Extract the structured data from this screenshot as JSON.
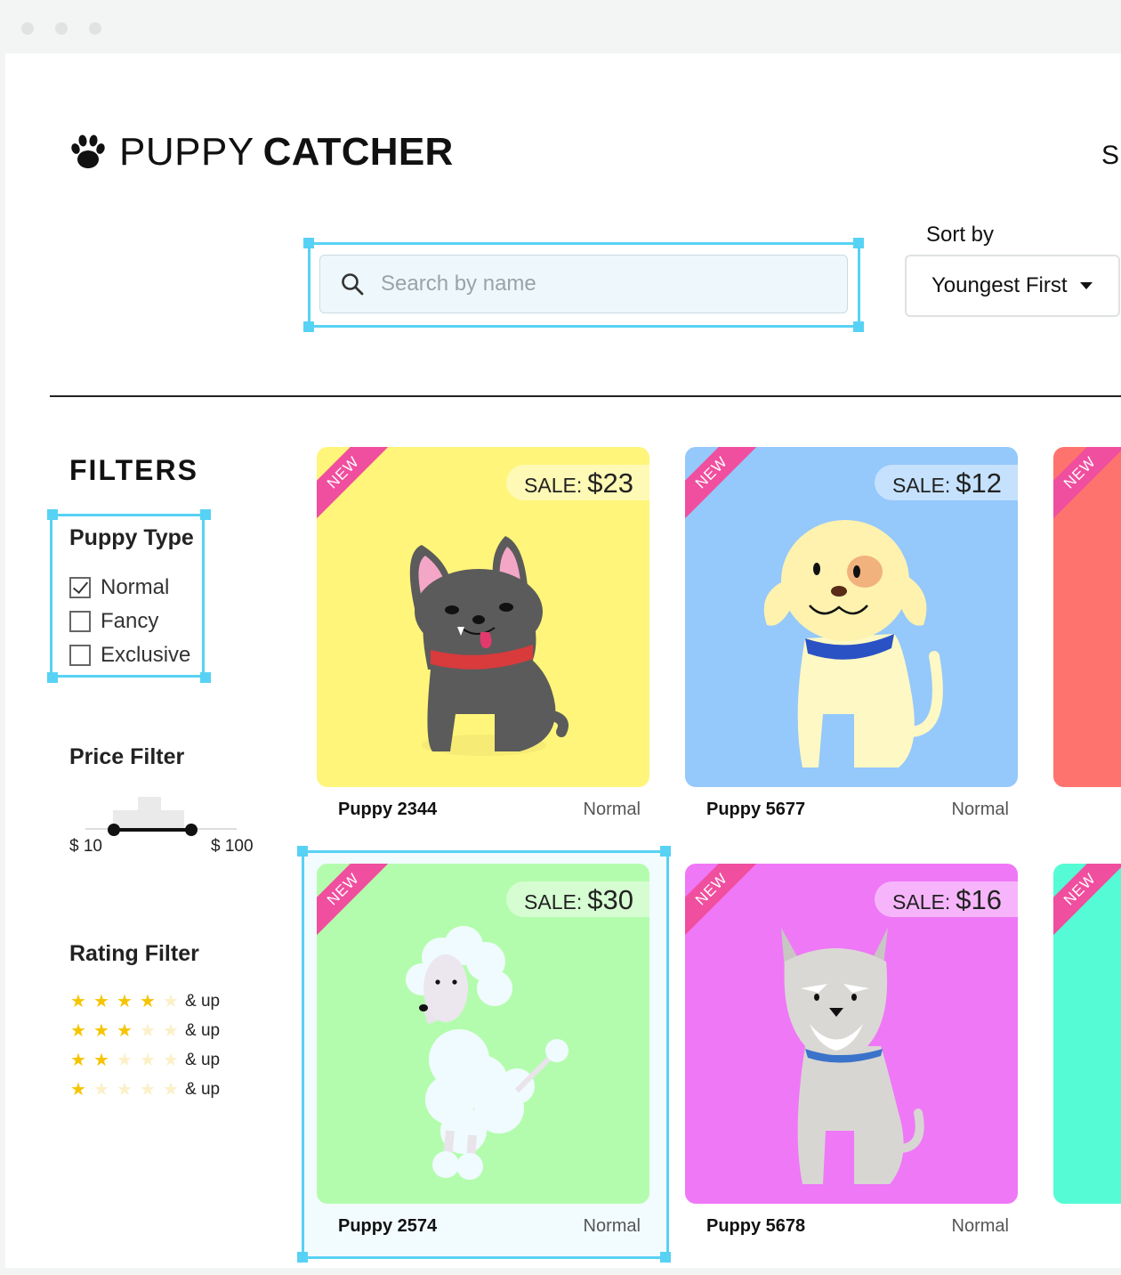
{
  "brand": {
    "name_light": "PUPPY",
    "name_bold": "CATCHER"
  },
  "header": {
    "signin_label": "Si"
  },
  "search": {
    "placeholder": "Search by name"
  },
  "sort": {
    "label": "Sort by",
    "selected": "Youngest First"
  },
  "filters": {
    "title": "FILTERS",
    "puppy_type": {
      "title": "Puppy Type",
      "options": [
        {
          "label": "Normal",
          "checked": true
        },
        {
          "label": "Fancy",
          "checked": false
        },
        {
          "label": "Exclusive",
          "checked": false
        }
      ]
    },
    "price": {
      "title": "Price Filter",
      "min_label": "$ 10",
      "max_label": "$ 100"
    },
    "rating": {
      "title": "Rating Filter",
      "rows": [
        {
          "stars": 4,
          "label": "& up"
        },
        {
          "stars": 3,
          "label": "& up"
        },
        {
          "stars": 2,
          "label": "& up"
        },
        {
          "stars": 1,
          "label": "& up"
        }
      ]
    }
  },
  "colors": {
    "selection": "#58d2f4",
    "ribbon": "#f04e9e",
    "star_on": "#f6c400"
  },
  "cards": [
    {
      "name": "Puppy 2344",
      "type": "Normal",
      "sale_label": "SALE:",
      "price": "$23",
      "badge": "NEW",
      "bg": "#fff57a",
      "art": "bulldog"
    },
    {
      "name": "Puppy 5677",
      "type": "Normal",
      "sale_label": "SALE:",
      "price": "$12",
      "badge": "NEW",
      "bg": "#95c8fb",
      "art": "lab"
    },
    {
      "name": "",
      "type": "",
      "sale_label": "",
      "price": "",
      "badge": "NEW",
      "bg": "#ff736f",
      "art": "none"
    },
    {
      "name": "Puppy 2574",
      "type": "Normal",
      "sale_label": "SALE:",
      "price": "$30",
      "badge": "NEW",
      "bg": "#b4fcad",
      "art": "poodle"
    },
    {
      "name": "Puppy 5678",
      "type": "Normal",
      "sale_label": "SALE:",
      "price": "$16",
      "badge": "NEW",
      "bg": "#ef78f7",
      "art": "terrier"
    },
    {
      "name": "",
      "type": "",
      "sale_label": "",
      "price": "",
      "badge": "NEW",
      "bg": "#55fbd5",
      "art": "none"
    }
  ]
}
